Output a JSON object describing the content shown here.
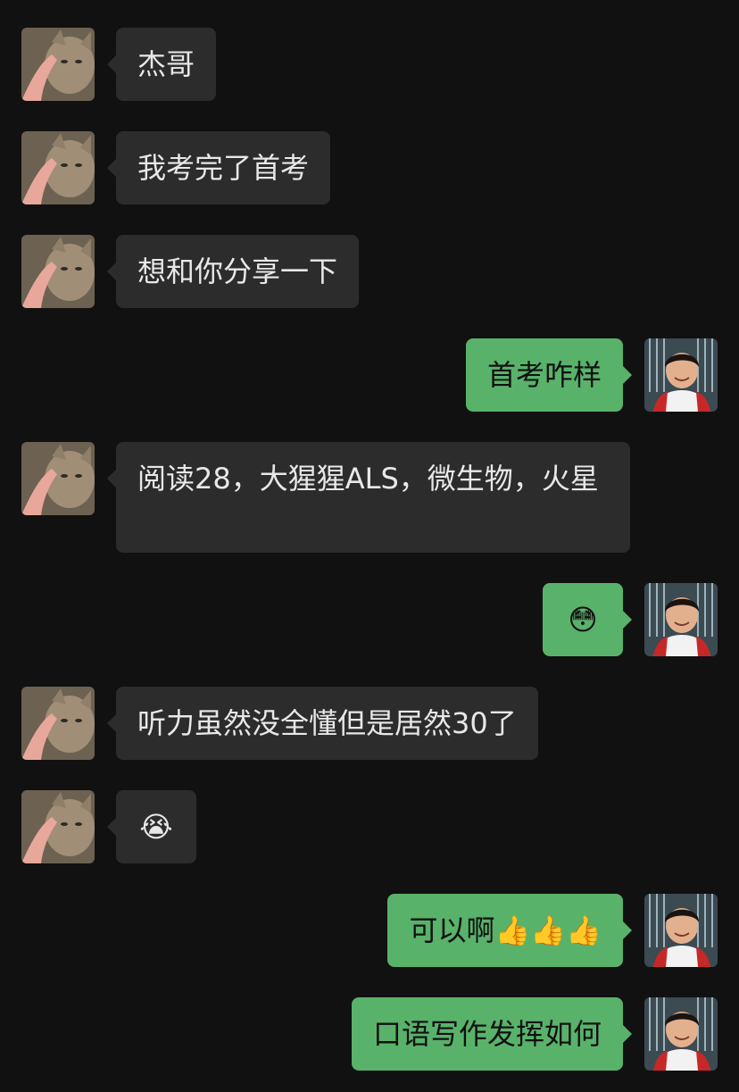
{
  "messages": [
    {
      "side": "in",
      "text": "杰哥"
    },
    {
      "side": "in",
      "text": "我考完了首考"
    },
    {
      "side": "in",
      "text": "想和你分享一下"
    },
    {
      "side": "out",
      "text": "首考咋样"
    },
    {
      "side": "in",
      "text": "阅读28，大猩猩ALS，微生物，火星"
    },
    {
      "side": "out",
      "text": "😳"
    },
    {
      "side": "in",
      "text": "听力虽然没全懂但是居然30了"
    },
    {
      "side": "in",
      "text": "😭"
    },
    {
      "side": "out",
      "text": "可以啊👍👍👍"
    },
    {
      "side": "out",
      "text": "口语写作发挥如何"
    }
  ],
  "avatars": {
    "left": "cat-avatar",
    "right": "boy-avatar"
  },
  "colors": {
    "background": "#111111",
    "incoming_bubble": "#2c2c2c",
    "outgoing_bubble": "#59b26a"
  }
}
